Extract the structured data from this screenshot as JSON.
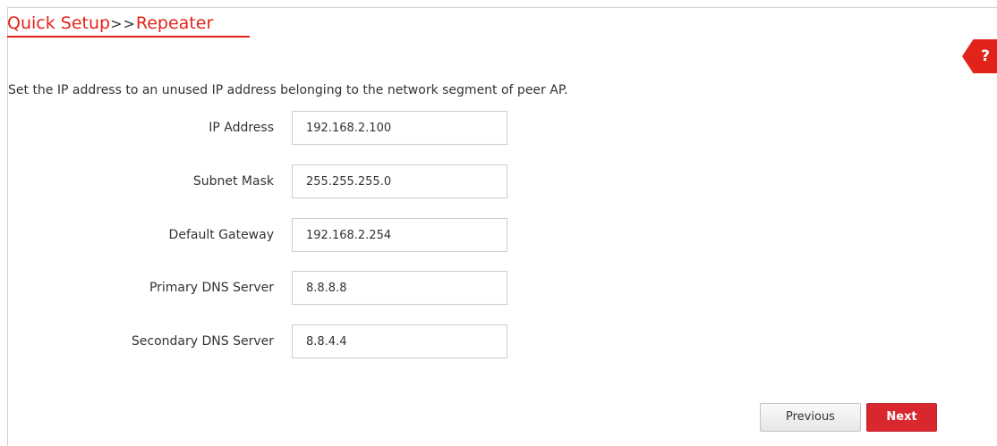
{
  "header": {
    "crumb_parent": "Quick Setup",
    "crumb_separator": ">>",
    "crumb_current": "Repeater",
    "help_label": "?"
  },
  "instructions": "Set the IP address to an unused IP address belonging to the network segment of peer AP.",
  "fields": {
    "ip_address": {
      "label": "IP Address",
      "value": "192.168.2.100"
    },
    "subnet_mask": {
      "label": "Subnet Mask",
      "value": "255.255.255.0"
    },
    "default_gateway": {
      "label": "Default Gateway",
      "value": "192.168.2.254"
    },
    "primary_dns": {
      "label": "Primary DNS Server",
      "value": "8.8.8.8"
    },
    "secondary_dns": {
      "label": "Secondary DNS Server",
      "value": "8.8.4.4"
    }
  },
  "buttons": {
    "previous": "Previous",
    "next": "Next"
  },
  "colors": {
    "accent": "#e2231a",
    "next_button": "#d9272e",
    "text": "#333333",
    "input_border": "#cccccc"
  }
}
